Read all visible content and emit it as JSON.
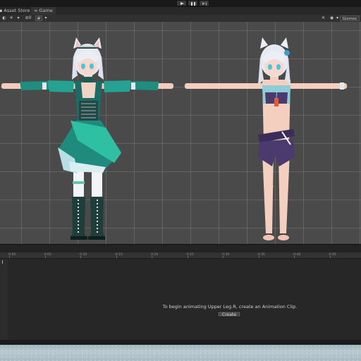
{
  "playbar": {
    "play_icon": "play-icon",
    "pause_icon": "pause-icon",
    "step_icon": "step-icon"
  },
  "tabs": [
    {
      "label": "Asset Store",
      "icon": "asset-store-icon"
    },
    {
      "label": "Game",
      "icon": "game-controller-icon"
    }
  ],
  "toolbar": {
    "hidden_count": "0",
    "gizmos_label": "Gizmos"
  },
  "scene": {
    "models": [
      {
        "name": "catgirl-maid-dress",
        "outfit": "teal dress with boots"
      },
      {
        "name": "catgirl-bikini",
        "outfit": "purple bikini"
      }
    ],
    "colors": {
      "background": "#4a4a4a",
      "grid": "#787878",
      "hair": "#e6e8f2",
      "dress": "#2aa58e",
      "skin": "#f4cfc0",
      "bikini": "#4a3a6e"
    }
  },
  "animation": {
    "ticks": [
      "0:00",
      "0:05",
      "0:10",
      "0:15",
      "0:20",
      "0:25",
      "0:30",
      "0:35",
      "0:40",
      "0:45"
    ],
    "message": "To begin animating Upper Leg.R, create an Animation Clip.",
    "create_label": "Create"
  }
}
